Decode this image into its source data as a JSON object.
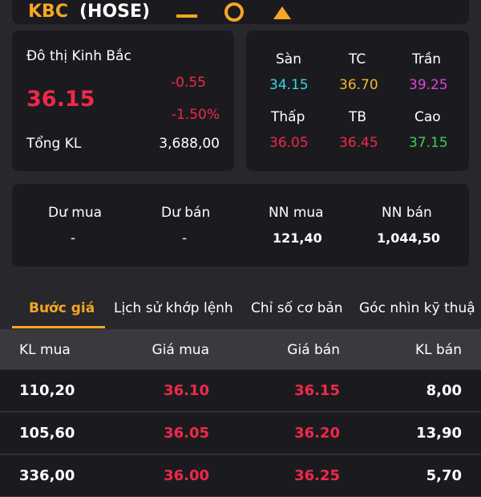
{
  "header": {
    "ticker": "KBC",
    "exchange": "(HOSE)"
  },
  "summary": {
    "company": "Đô thị Kinh Bắc",
    "price": "36.15",
    "change": "-0.55",
    "change_pct": "-1.50%",
    "volume_label": "Tổng KL",
    "volume": "3,688,00"
  },
  "ref": {
    "san_label": "Sàn",
    "san": "34.15",
    "tc_label": "TC",
    "tc": "36.70",
    "tran_label": "Trần",
    "tran": "39.25",
    "thap_label": "Thấp",
    "thap": "36.05",
    "tb_label": "TB",
    "tb": "36.45",
    "cao_label": "Cao",
    "cao": "37.15"
  },
  "stats": [
    {
      "label": "Dư mua",
      "value": "-"
    },
    {
      "label": "Dư bán",
      "value": "-"
    },
    {
      "label": "NN mua",
      "value": "121,40"
    },
    {
      "label": "NN bán",
      "value": "1,044,50"
    }
  ],
  "tabs": [
    "Bước giá",
    "Lịch sử khớp lệnh",
    "Chỉ số cơ bản",
    "Góc nhìn kỹ thuậ"
  ],
  "table": {
    "headers": [
      "KL mua",
      "Giá mua",
      "Giá bán",
      "KL bán"
    ],
    "rows": [
      [
        "110,20",
        "36.10",
        "36.15",
        "8,00"
      ],
      [
        "105,60",
        "36.05",
        "36.20",
        "13,90"
      ],
      [
        "336,00",
        "36.00",
        "36.25",
        "5,70"
      ]
    ]
  },
  "colors": {
    "accent": "#f5a623",
    "down": "#f0284a"
  }
}
